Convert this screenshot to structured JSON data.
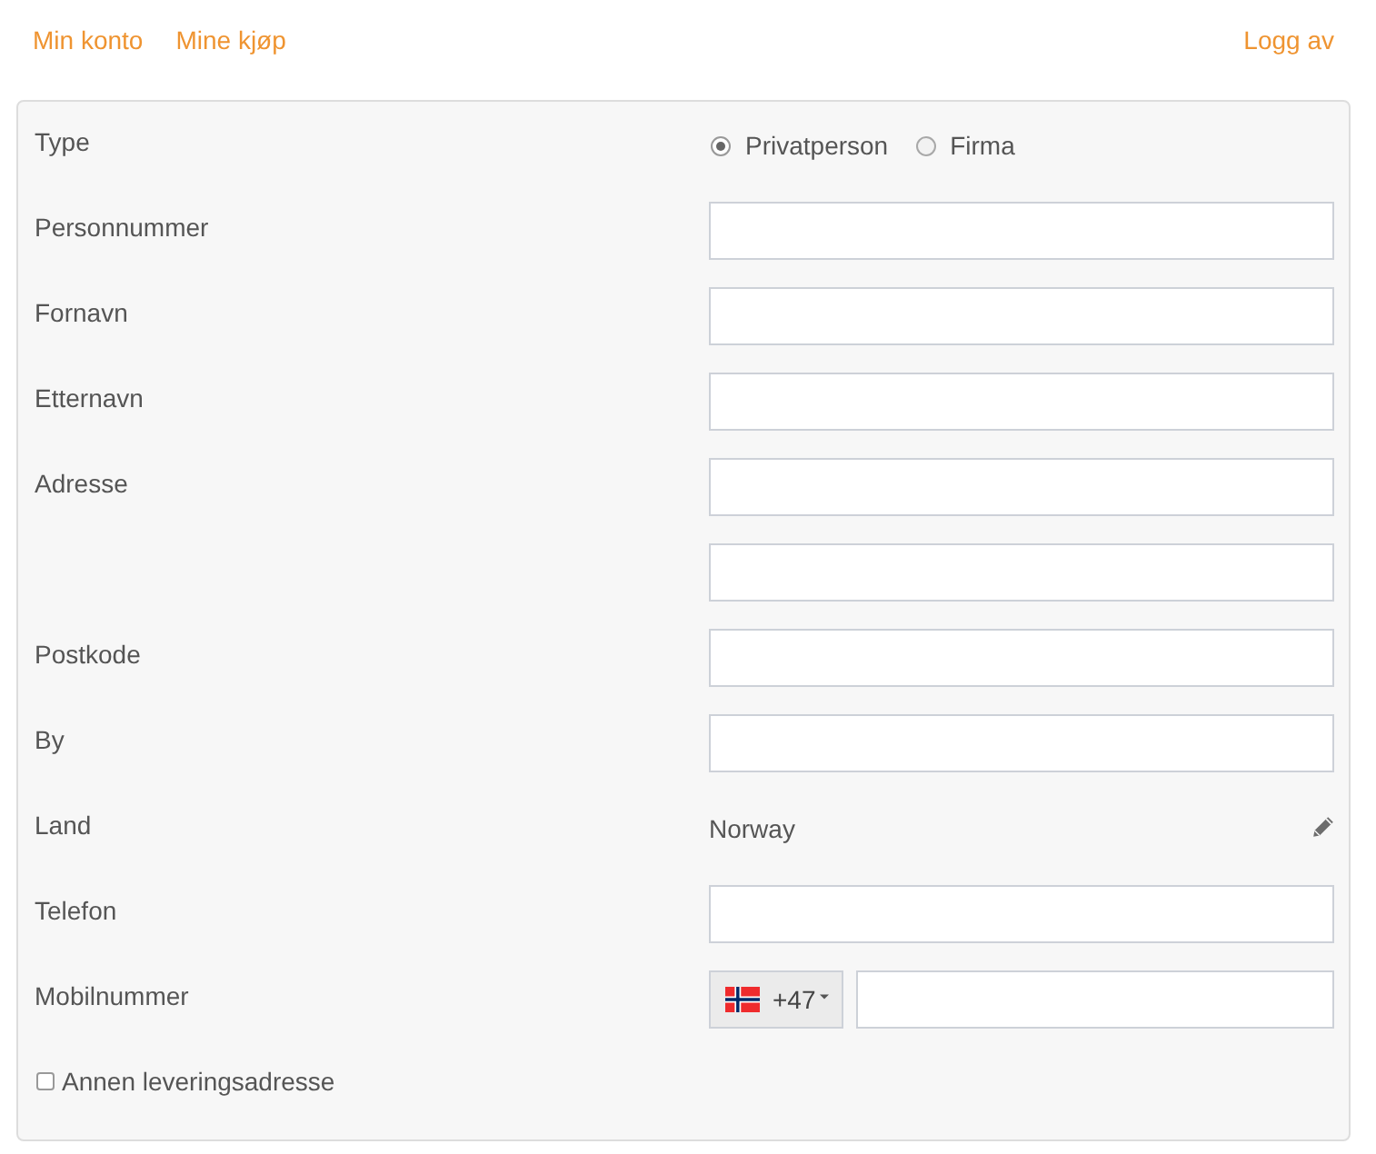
{
  "nav": {
    "left_links": [
      {
        "label": "Min konto"
      },
      {
        "label": "Mine kjøp"
      }
    ],
    "right_links": [
      {
        "label": "Logg av"
      }
    ]
  },
  "form": {
    "rows": [
      {
        "kind": "radio",
        "label": "Type",
        "options": [
          {
            "label": "Privatperson",
            "selected": true
          },
          {
            "label": "Firma",
            "selected": false
          }
        ]
      },
      {
        "kind": "input",
        "label": "Personnummer"
      },
      {
        "kind": "input",
        "label": "Fornavn"
      },
      {
        "kind": "input",
        "label": "Etternavn"
      },
      {
        "kind": "input",
        "label": "Adresse"
      },
      {
        "kind": "input"
      },
      {
        "kind": "input",
        "label": "Postkode"
      },
      {
        "kind": "input",
        "label": "By"
      },
      {
        "kind": "static",
        "label": "Land",
        "value": "Norway"
      },
      {
        "kind": "input",
        "label": "Telefon"
      },
      {
        "kind": "phone",
        "label": "Mobilnummer",
        "country_code": "+47"
      }
    ],
    "checkbox": {
      "label": "Annen leveringsadresse",
      "checked": false
    }
  }
}
